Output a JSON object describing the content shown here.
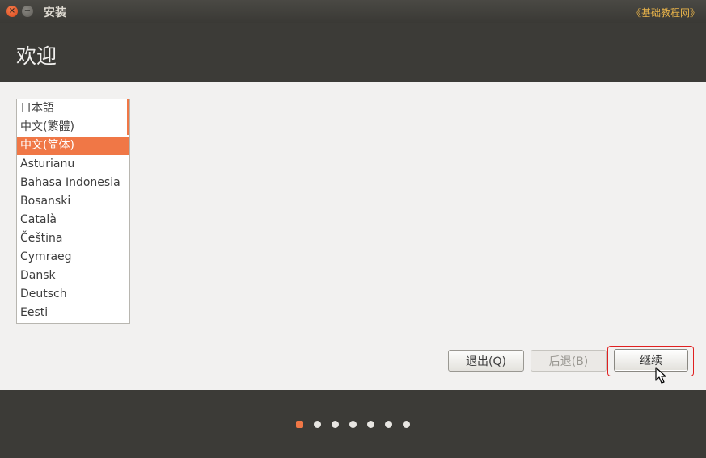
{
  "window": {
    "title": "安装",
    "watermark": "《基础教程网》",
    "close_glyph": "×",
    "minimize_glyph": "−"
  },
  "header": {
    "title": "欢迎"
  },
  "languages": {
    "items": [
      "日本語",
      "中文(繁體)",
      "中文(简体)",
      "Asturianu",
      "Bahasa Indonesia",
      "Bosanski",
      "Català",
      "Čeština",
      "Cymraeg",
      "Dansk",
      "Deutsch",
      "Eesti"
    ],
    "selected_index": 2
  },
  "buttons": {
    "quit": "退出(Q)",
    "back": "后退(B)",
    "continue": "继续"
  },
  "progress": {
    "total_steps": 7,
    "current_step": 1
  },
  "colors": {
    "accent": "#f07746",
    "dark": "#3c3b37",
    "highlight_ring": "#e02020"
  }
}
